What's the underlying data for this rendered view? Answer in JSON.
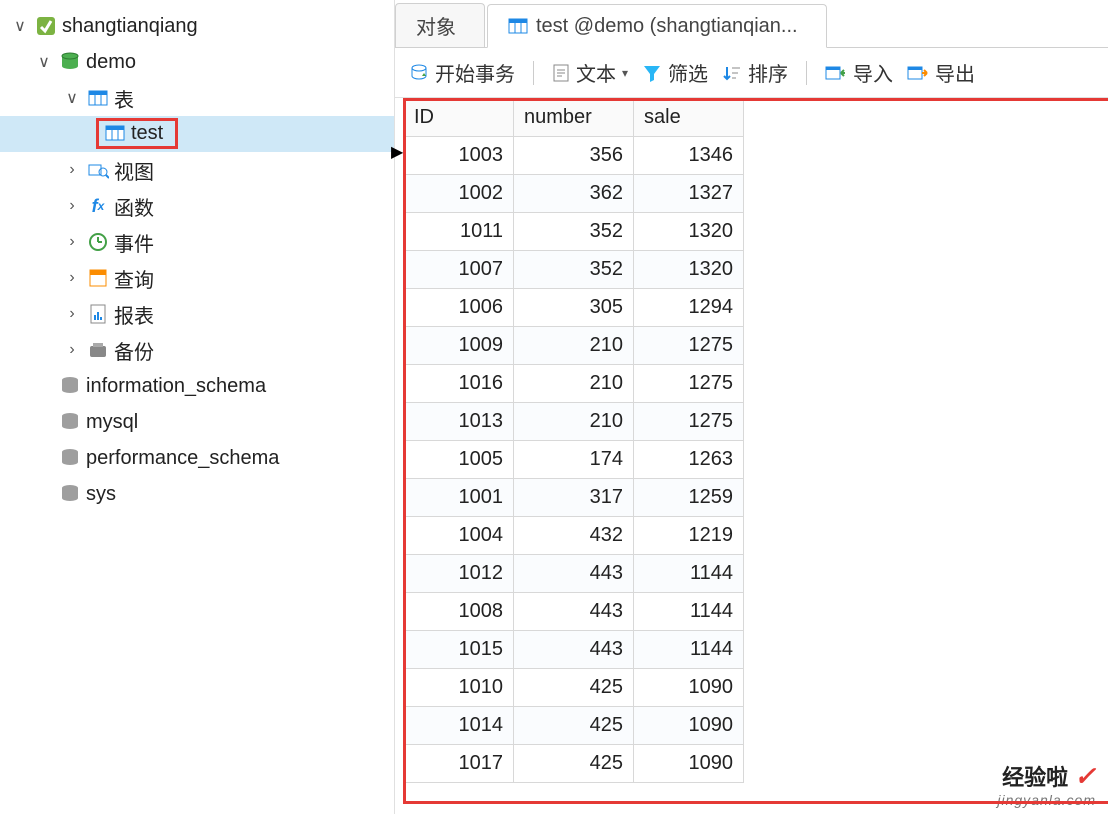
{
  "sidebar": {
    "connection": "shangtianqiang",
    "database": "demo",
    "nodes": {
      "tables": "表",
      "test": "test",
      "views": "视图",
      "functions": "函数",
      "events": "事件",
      "queries": "查询",
      "reports": "报表",
      "backup": "备份"
    },
    "schemas": [
      "information_schema",
      "mysql",
      "performance_schema",
      "sys"
    ]
  },
  "tabs": {
    "objects": "对象",
    "active": "test @demo (shangtianqian..."
  },
  "toolbar": {
    "begin_trans": "开始事务",
    "text": "文本",
    "filter": "筛选",
    "sort": "排序",
    "import": "导入",
    "export": "导出"
  },
  "table": {
    "columns": [
      "ID",
      "number",
      "sale"
    ],
    "rows": [
      {
        "ID": 1003,
        "number": 356,
        "sale": 1346
      },
      {
        "ID": 1002,
        "number": 362,
        "sale": 1327
      },
      {
        "ID": 1011,
        "number": 352,
        "sale": 1320
      },
      {
        "ID": 1007,
        "number": 352,
        "sale": 1320
      },
      {
        "ID": 1006,
        "number": 305,
        "sale": 1294
      },
      {
        "ID": 1009,
        "number": 210,
        "sale": 1275
      },
      {
        "ID": 1016,
        "number": 210,
        "sale": 1275
      },
      {
        "ID": 1013,
        "number": 210,
        "sale": 1275
      },
      {
        "ID": 1005,
        "number": 174,
        "sale": 1263
      },
      {
        "ID": 1001,
        "number": 317,
        "sale": 1259
      },
      {
        "ID": 1004,
        "number": 432,
        "sale": 1219
      },
      {
        "ID": 1012,
        "number": 443,
        "sale": 1144
      },
      {
        "ID": 1008,
        "number": 443,
        "sale": 1144
      },
      {
        "ID": 1015,
        "number": 443,
        "sale": 1144
      },
      {
        "ID": 1010,
        "number": 425,
        "sale": 1090
      },
      {
        "ID": 1014,
        "number": 425,
        "sale": 1090
      },
      {
        "ID": 1017,
        "number": 425,
        "sale": 1090
      }
    ]
  },
  "watermark": {
    "line1": "经验啦",
    "line2": "jingyanla.com"
  }
}
